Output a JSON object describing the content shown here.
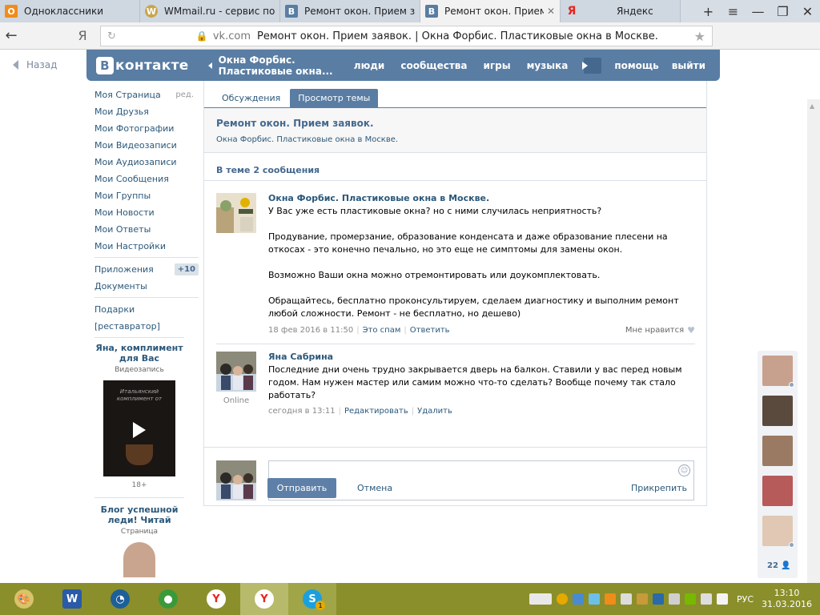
{
  "browser": {
    "tabs": [
      {
        "title": "Одноклассники",
        "active": false,
        "color": "#f08c1a",
        "glyph": "О"
      },
      {
        "title": "WMmail.ru - сервис почтовых",
        "active": false,
        "color": "#c9a64a",
        "glyph": "W"
      },
      {
        "title": "Ремонт окон. Прием заявок.",
        "active": false,
        "color": "#597da3",
        "glyph": "В"
      },
      {
        "title": "Ремонт окон. Прием заявок.",
        "active": true,
        "color": "#597da3",
        "glyph": "В"
      },
      {
        "title": "Яндекс",
        "active": false,
        "color": "#e52620",
        "glyph": "Я"
      }
    ],
    "new_tab": "+",
    "window_controls": [
      "≡",
      "—",
      "❐",
      "✕"
    ],
    "back_glyph": "←",
    "yandex_glyph": "Я",
    "reload_glyph": "↻",
    "address_domain": "vk.com",
    "address_title": "Ремонт окон. Прием заявок. | Окна Форбис. Пластиковые окна в Москве.",
    "bookmark_glyph": "★"
  },
  "vk": {
    "back_link": "Назад",
    "logo_text": "контакте",
    "logo_letter": "В",
    "nav_back": "Окна Форбис. Пластиковые окна...",
    "nav_links": [
      "люди",
      "сообщества",
      "игры",
      "музыка"
    ],
    "nav_right": [
      "помощь",
      "выйти"
    ],
    "sidebar": {
      "items": [
        {
          "label": "Моя Страница",
          "aux": "ред."
        },
        {
          "label": "Мои Друзья"
        },
        {
          "label": "Мои Фотографии"
        },
        {
          "label": "Мои Видеозаписи"
        },
        {
          "label": "Мои Аудиозаписи"
        },
        {
          "label": "Мои Сообщения"
        },
        {
          "label": "Мои Группы"
        },
        {
          "label": "Мои Новости"
        },
        {
          "label": "Мои Ответы"
        },
        {
          "label": "Мои Настройки"
        }
      ],
      "items2": [
        {
          "label": "Приложения",
          "count": "+10"
        },
        {
          "label": "Документы"
        }
      ],
      "items3": [
        {
          "label": "Подарки"
        },
        {
          "label": "[реставратор]"
        }
      ],
      "ad1": {
        "title": "Яна, комплимент для Вас",
        "subtitle": "Видеозапись",
        "video_text": "Итальянский комплимент от",
        "age": "18+"
      },
      "ad2": {
        "title": "Блог успешной леди! Читай",
        "subtitle": "Страница"
      }
    },
    "tabs": [
      {
        "label": "Обсуждения",
        "selected": false
      },
      {
        "label": "Просмотр темы",
        "selected": true
      }
    ],
    "topic": {
      "title": "Ремонт окон. Прием заявок.",
      "group": "Окна Форбис. Пластиковые окна в Москве."
    },
    "count_label": "В теме 2 сообщения",
    "posts": [
      {
        "author": "Окна Форбис. Пластиковые окна в Москве.",
        "paragraphs": [
          "У Вас уже есть пластиковые окна? но с ними случилась неприятность?",
          "Продувание, промерзание, образование конденсата и даже образование плесени на откосах - это конечно печально, но это еще не симптомы для замены окон.",
          "Возможно Ваши окна можно отремонтировать или доукомплектовать.",
          "Обращайтесь, бесплатно проконсультируем, сделаем диагностику и выполним ремонт любой сложности. Ремонт - не бесплатно, но дешево)"
        ],
        "date": "18 фев 2016 в 11:50",
        "actions": [
          "Это спам",
          "Ответить"
        ],
        "like": "Мне нравится"
      },
      {
        "author": "Яна Сабрина",
        "paragraphs": [
          "Последние дни очень трудно закрывается дверь на балкон. Ставили у вас перед новым годом. Нам нужен мастер или самим можно что-то сделать? Вообще почему так стало работать?"
        ],
        "date": "сегодня в 13:11",
        "actions": [
          "Редактировать",
          "Удалить"
        ],
        "status": "Online"
      }
    ],
    "reply": {
      "send": "Отправить",
      "cancel": "Отмена",
      "attach": "Прикрепить"
    },
    "friends_count": "22"
  },
  "taskbar": {
    "lang": "РУС",
    "time": "13:10",
    "date": "31.03.2016",
    "skype_badge": "1"
  },
  "colors": {
    "vk_blue": "#597da3",
    "link": "#2b587a",
    "taskbar": "#8a8f2b"
  }
}
